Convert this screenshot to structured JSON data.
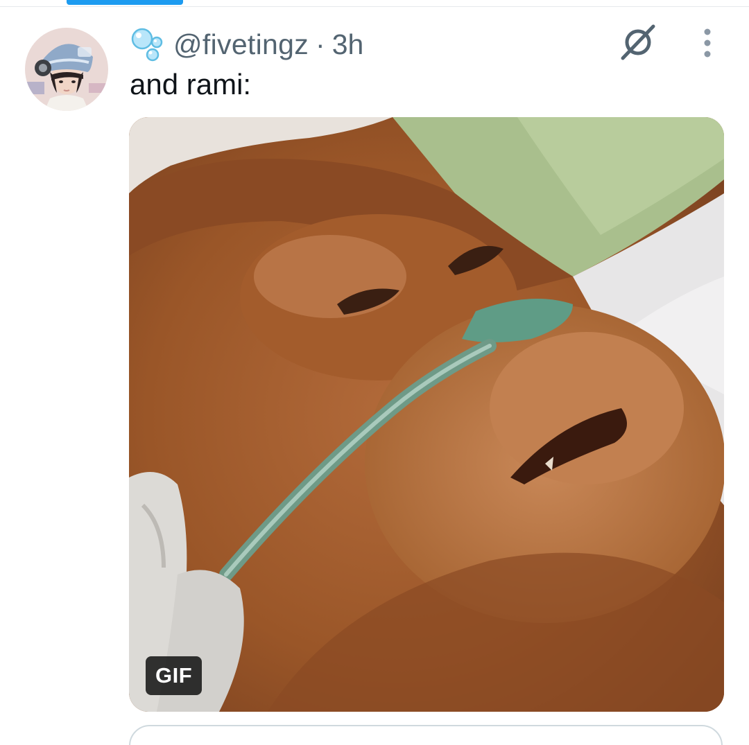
{
  "tweet": {
    "handle": "@fivetingz",
    "separator": "·",
    "time": "3h",
    "text": "and rami:",
    "media": {
      "badge": "GIF"
    }
  },
  "icons": {
    "name_emoji": "bubbles-icon",
    "grok": "grok-icon",
    "more": "more-vertical-icon"
  },
  "colors": {
    "accent": "#1d9bf0",
    "secondary_text": "#536471",
    "primary_text": "#0f1419",
    "border": "#cfd9de"
  }
}
